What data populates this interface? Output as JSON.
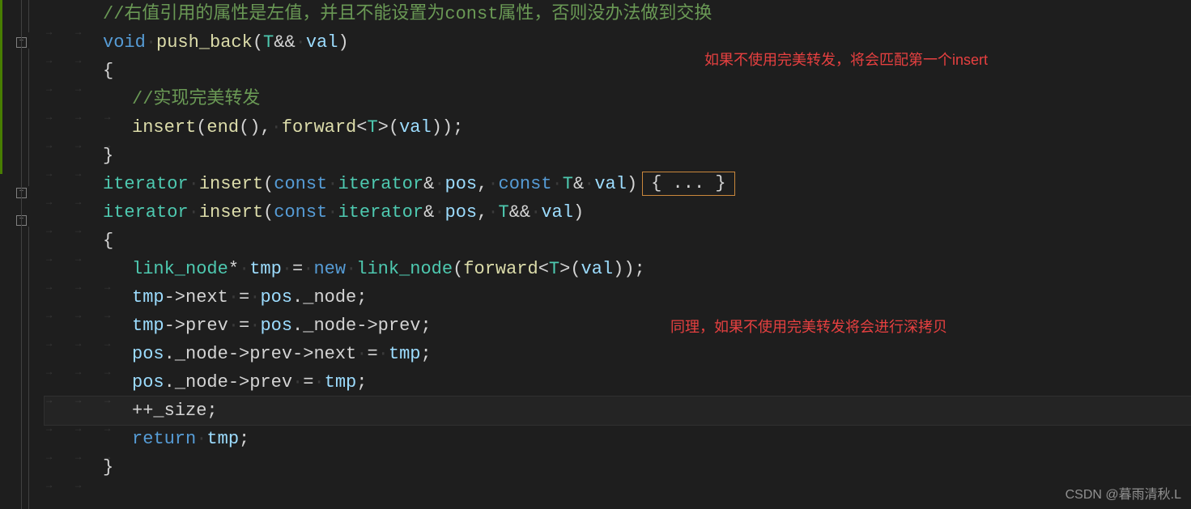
{
  "code": {
    "l1_comment": "//右值引用的属性是左值，并且不能设置为const属性，否则没办法做到交换",
    "l2_void": "void",
    "l2_func": "push_back",
    "l2_type": "T",
    "l2_amp": "&&",
    "l2_param": "val",
    "l3_brace": "{",
    "l4_comment": "//实现完美转发",
    "l5_insert": "insert",
    "l5_end": "end",
    "l5_forward": "forward",
    "l5_T": "T",
    "l5_val": "val",
    "l6_brace": "}",
    "l7_iterator": "iterator",
    "l7_insert": "insert",
    "l7_const1": "const",
    "l7_itertype": "iterator",
    "l7_amp": "&",
    "l7_pos": "pos",
    "l7_const2": "const",
    "l7_T": "T",
    "l7_amp2": "&",
    "l7_val": "val",
    "l7_folded": "{ ... }",
    "l8_iterator": "iterator",
    "l8_insert": "insert",
    "l8_const": "const",
    "l8_itertype": "iterator",
    "l8_amp": "&",
    "l8_pos": "pos",
    "l8_T": "T",
    "l8_amp2": "&&",
    "l8_val": "val",
    "l9_brace": "{",
    "l10_linknode": "link_node",
    "l10_star": "*",
    "l10_tmp": "tmp",
    "l10_eq": "=",
    "l10_new": "new",
    "l10_linknode2": "link_node",
    "l10_forward": "forward",
    "l10_T": "T",
    "l10_val": "val",
    "l11_tmp": "tmp",
    "l11_next": "next",
    "l11_pos": "pos",
    "l11_node": "_node",
    "l12_tmp": "tmp",
    "l12_prev": "prev",
    "l12_pos": "pos",
    "l12_node": "_node",
    "l12_prev2": "prev",
    "l13_pos": "pos",
    "l13_node": "_node",
    "l13_prev": "prev",
    "l13_next": "next",
    "l13_tmp": "tmp",
    "l14_pos": "pos",
    "l14_node": "_node",
    "l14_prev": "prev",
    "l14_tmp": "tmp",
    "l15_size": "_size",
    "l16_return": "return",
    "l16_tmp": "tmp",
    "l17_brace": "}"
  },
  "annotations": {
    "a1": "如果不使用完美转发，将会匹配第一个insert",
    "a2": "同理，如果不使用完美转发将会进行深拷贝"
  },
  "watermark": "CSDN @暮雨清秋.L"
}
